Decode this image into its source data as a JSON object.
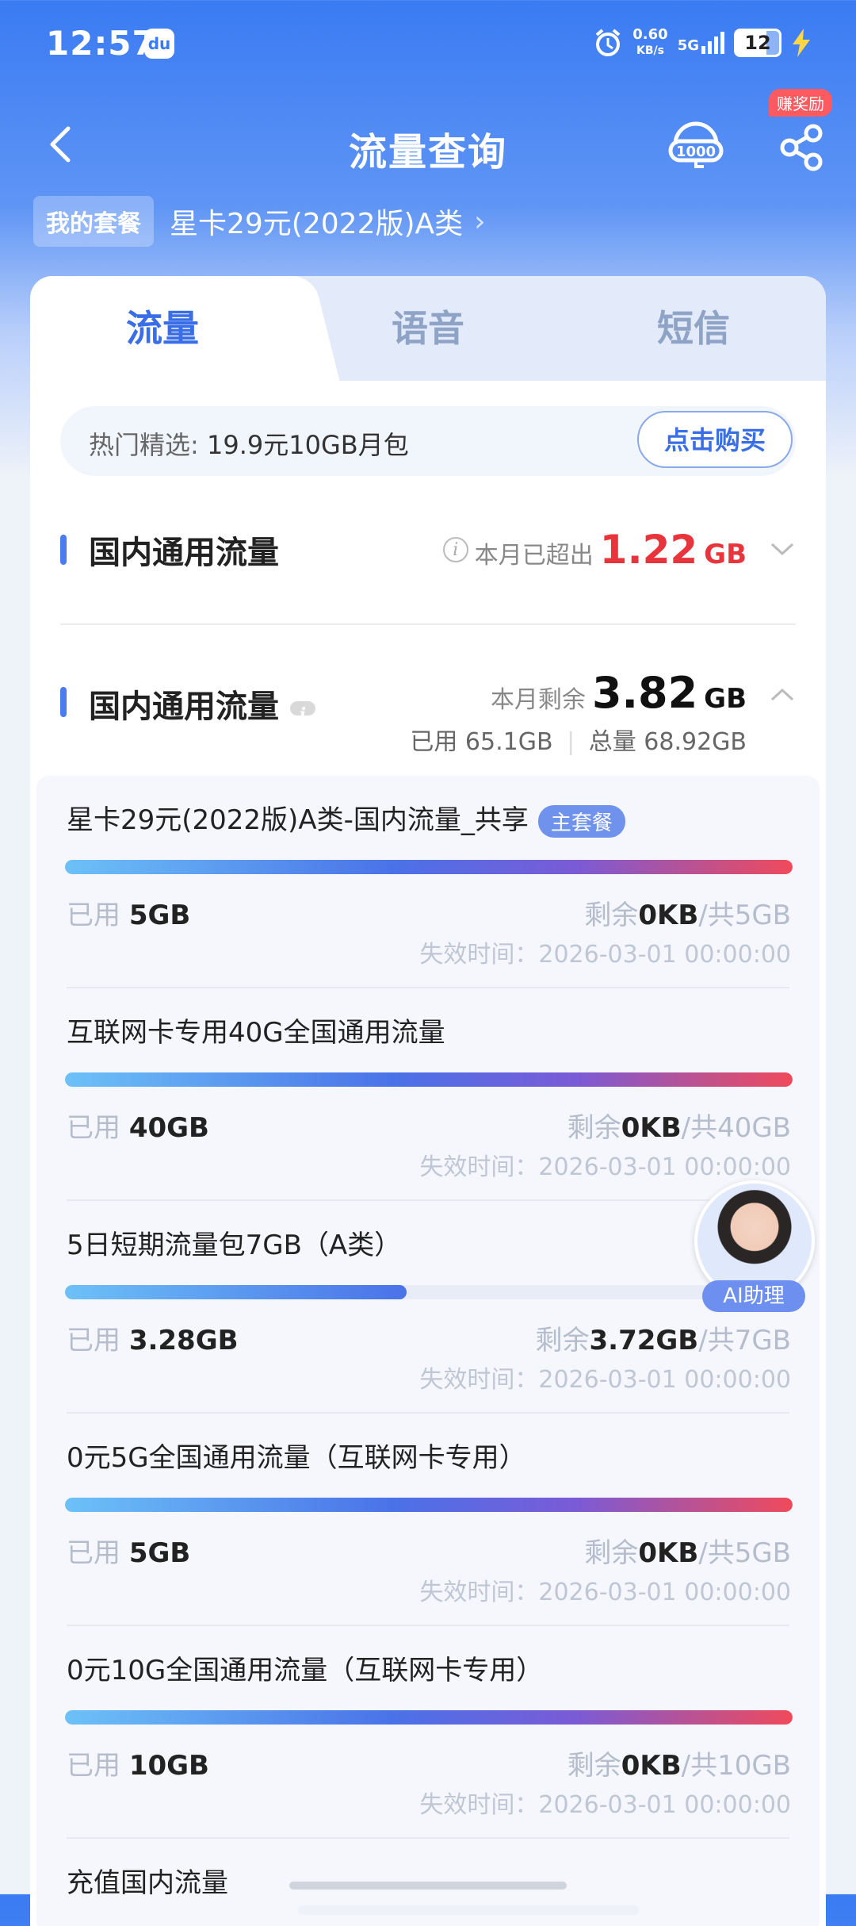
{
  "status": {
    "time": "12:57",
    "app_badge": "du",
    "speed_value": "0.60",
    "speed_unit": "KB/s",
    "network": "5G",
    "battery": "12"
  },
  "header": {
    "title": "流量查询",
    "reward_badge": "赚奖励"
  },
  "plan": {
    "tag": "我的套餐",
    "name": "星卡29元(2022版)A类",
    "chevron": "›"
  },
  "tabs": [
    "流量",
    "语音",
    "短信"
  ],
  "promo": {
    "label": "热门精选:",
    "text": "19.9元10GB月包",
    "button": "点击购买"
  },
  "section1": {
    "title": "国内通用流量",
    "exceeded_label": "本月已超出",
    "exceeded_value": "1.22",
    "exceeded_unit": "GB"
  },
  "section2": {
    "title": "国内通用流量",
    "remaining_label": "本月剩余",
    "remaining_value": "3.82",
    "remaining_unit": "GB",
    "used_label": "已用",
    "used_value": "65.1GB",
    "total_label": "总量",
    "total_value": "68.92GB"
  },
  "packages": [
    {
      "name": "星卡29元(2022版)A类-国内流量_共享",
      "badge": "主套餐",
      "used_label": "已用",
      "used": "5GB",
      "remain_label": "剩余",
      "remain": "0KB",
      "total": "/共5GB",
      "expire": "失效时间：2026-03-01 00:00:00",
      "usage_fraction": 1.0
    },
    {
      "name": "互联网卡专用40G全国通用流量",
      "used_label": "已用",
      "used": "40GB",
      "remain_label": "剩余",
      "remain": "0KB",
      "total": "/共40GB",
      "expire": "失效时间：2026-03-01 00:00:00",
      "usage_fraction": 1.0
    },
    {
      "name": "5日短期流量包7GB（A类）",
      "used_label": "已用",
      "used": "3.28GB",
      "remain_label": "剩余",
      "remain": "3.72GB",
      "total": "/共7GB",
      "expire": "失效时间：2026-03-01 00:00:00",
      "usage_fraction": 0.47
    },
    {
      "name": "0元5G全国通用流量（互联网卡专用）",
      "used_label": "已用",
      "used": "5GB",
      "remain_label": "剩余",
      "remain": "0KB",
      "total": "/共5GB",
      "expire": "失效时间：2026-03-01 00:00:00",
      "usage_fraction": 1.0
    },
    {
      "name": "0元10G全国通用流量（互联网卡专用）",
      "used_label": "已用",
      "used": "10GB",
      "remain_label": "剩余",
      "remain": "0KB",
      "total": "/共10GB",
      "expire": "失效时间：2026-03-01 00:00:00",
      "usage_fraction": 1.0
    },
    {
      "name": "充值国内流量"
    }
  ],
  "ai_assistant": {
    "label": "AI助理"
  },
  "colors": {
    "brand_blue": "#3a7bf3",
    "accent_red": "#e8343d",
    "tab_active": "#3a6ee6"
  }
}
